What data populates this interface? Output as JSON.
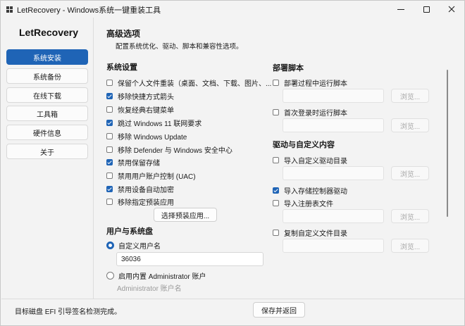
{
  "window": {
    "title": "LetRecovery - Windows系统一键重装工具",
    "icon": "app-grid-icon",
    "controls": [
      "minimize-icon",
      "maximize-icon",
      "close-icon"
    ]
  },
  "sidebar": {
    "brand": "LetRecovery",
    "items": [
      {
        "label": "系统安装",
        "active": true
      },
      {
        "label": "系统备份",
        "active": false
      },
      {
        "label": "在线下载",
        "active": false
      },
      {
        "label": "工具箱",
        "active": false
      },
      {
        "label": "硬件信息",
        "active": false
      },
      {
        "label": "关于",
        "active": false
      }
    ]
  },
  "main": {
    "title": "高级选项",
    "subtitle": "配置系统优化、驱动、脚本和兼容性选项。",
    "system_settings": {
      "title": "系统设置",
      "options": [
        {
          "label": "保留个人文件重装（桌面、文档、下载、图片、...",
          "checked": false
        },
        {
          "label": "移除快捷方式箭头",
          "checked": true
        },
        {
          "label": "恢复经典右键菜单",
          "checked": false
        },
        {
          "label": "跳过 Windows 11 联网要求",
          "checked": true
        },
        {
          "label": "移除 Windows Update",
          "checked": false
        },
        {
          "label": "移除 Defender 与 Windows 安全中心",
          "checked": false
        },
        {
          "label": "禁用保留存储",
          "checked": true
        },
        {
          "label": "禁用用户账户控制 (UAC)",
          "checked": false
        },
        {
          "label": "禁用设备自动加密",
          "checked": true
        },
        {
          "label": "移除指定预装应用",
          "checked": false
        }
      ],
      "select_apps_button": "选择预装应用..."
    },
    "user_disk": {
      "title": "用户与系统盘",
      "custom_username_label": "自定义用户名",
      "custom_username_selected": true,
      "username_value": "36036",
      "enable_admin_label": "启用内置 Administrator 账户",
      "enable_admin_selected": false,
      "admin_username_placeholder": "Administrator 账户名"
    },
    "scripts": {
      "title": "部署脚本",
      "items": [
        {
          "label": "部署过程中运行脚本",
          "checked": false,
          "path": "",
          "browse": "浏览..."
        },
        {
          "label": "首次登录时运行脚本",
          "checked": false,
          "path": "",
          "browse": "浏览..."
        }
      ]
    },
    "drivers": {
      "title": "驱动与自定义内容",
      "import_driver": {
        "label": "导入自定义驱动目录",
        "checked": false,
        "path": "",
        "browse": "浏览..."
      },
      "import_storage": {
        "label": "导入存储控制器驱动",
        "checked": true
      },
      "import_registry": {
        "label": "导入注册表文件",
        "checked": false,
        "path": "",
        "browse": "浏览..."
      },
      "copy_files": {
        "label": "复制自定义文件目录",
        "checked": false,
        "path": "",
        "browse": "浏览..."
      }
    }
  },
  "footer": {
    "status": "目标磁盘 EFI 引导签名检测完成。",
    "save_button": "保存并返回"
  }
}
